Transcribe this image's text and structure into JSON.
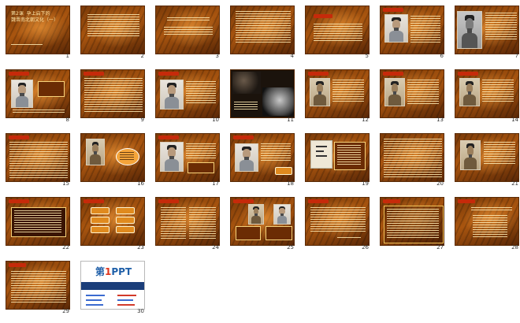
{
  "page": {
    "title": "Slide sorter view"
  },
  "slides": [
    {
      "n": "1",
      "title": "第2课  孕上启下的\n魏晋南北朝文化（一）"
    },
    {
      "n": "2",
      "title": ""
    },
    {
      "n": "3",
      "title": ""
    },
    {
      "n": "4",
      "title": ""
    },
    {
      "n": "5",
      "title": ""
    },
    {
      "n": "6",
      "title": ""
    },
    {
      "n": "7",
      "title": ""
    },
    {
      "n": "8",
      "title": ""
    },
    {
      "n": "9",
      "title": ""
    },
    {
      "n": "10",
      "title": ""
    },
    {
      "n": "11",
      "title": ""
    },
    {
      "n": "12",
      "title": ""
    },
    {
      "n": "13",
      "title": ""
    },
    {
      "n": "14",
      "title": ""
    },
    {
      "n": "15",
      "title": ""
    },
    {
      "n": "16",
      "title": ""
    },
    {
      "n": "17",
      "title": ""
    },
    {
      "n": "18",
      "title": ""
    },
    {
      "n": "19",
      "title": ""
    },
    {
      "n": "20",
      "title": ""
    },
    {
      "n": "21",
      "title": ""
    },
    {
      "n": "22",
      "title": ""
    },
    {
      "n": "23",
      "title": ""
    },
    {
      "n": "24",
      "title": ""
    },
    {
      "n": "25",
      "title": ""
    },
    {
      "n": "26",
      "title": ""
    },
    {
      "n": "27",
      "title": ""
    },
    {
      "n": "28",
      "title": ""
    },
    {
      "n": "29",
      "title": ""
    },
    {
      "n": "30",
      "title": "第1PPT"
    }
  ],
  "logo": {
    "prefix": "第",
    "one": "1",
    "suffix": "PPT"
  },
  "colors": {
    "slide_bg": "#8a430b",
    "accent_red": "#c62a0a",
    "text_gold": "#ffd57a",
    "logo_blue": "#1f5fa8"
  }
}
